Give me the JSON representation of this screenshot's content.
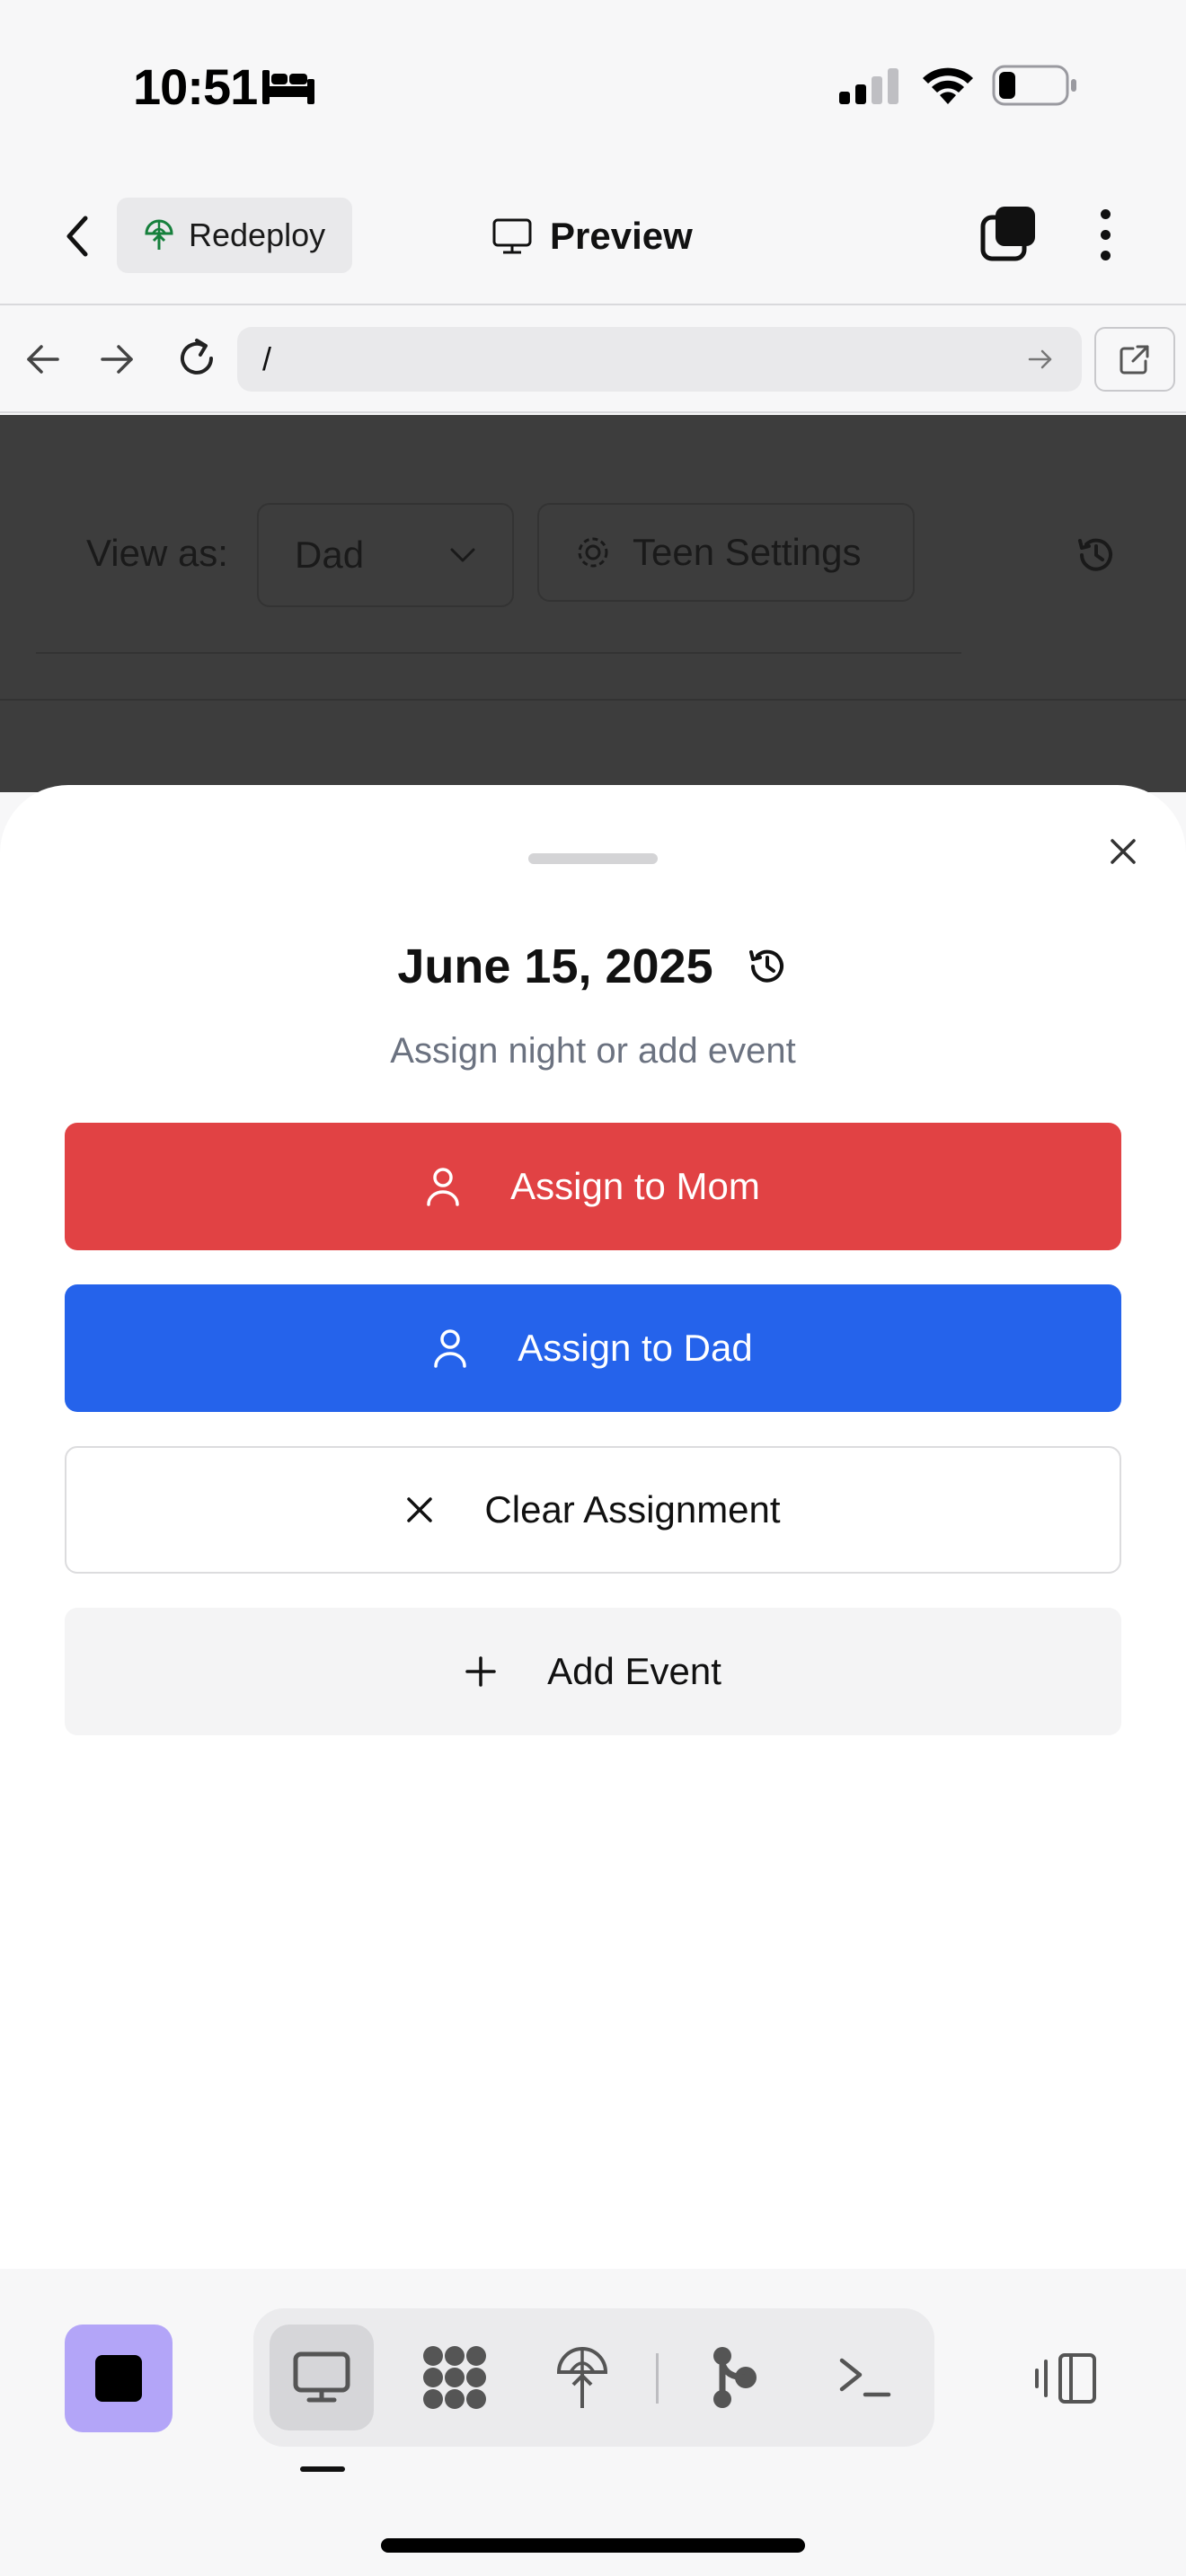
{
  "status_bar": {
    "time": "10:51"
  },
  "header": {
    "redeploy_label": "Redeploy",
    "title": "Preview"
  },
  "browser": {
    "url": "/"
  },
  "webpage": {
    "view_as_label": "View as:",
    "view_as_value": "Dad",
    "teen_settings_label": "Teen Settings"
  },
  "sheet": {
    "title": "June 15, 2025",
    "subtitle": "Assign night or add event",
    "buttons": {
      "assign_mom": "Assign to Mom",
      "assign_dad": "Assign to Dad",
      "clear": "Clear Assignment",
      "add_event": "Add Event"
    }
  },
  "colors": {
    "mom": "#e14244",
    "dad": "#2563eb",
    "stop_button": "#b3a5f8",
    "dim_overlay": "#3d3d3d"
  },
  "icons": [
    "bed-icon",
    "signal-icon",
    "wifi-icon",
    "battery-icon",
    "back-icon",
    "redeploy-icon",
    "monitor-icon",
    "tabs-icon",
    "more-icon",
    "arrow-left-icon",
    "arrow-right-icon",
    "reload-icon",
    "external-link-icon",
    "chevron-down-icon",
    "gear-icon",
    "history-icon",
    "close-icon",
    "user-icon",
    "plus-icon",
    "workflows-icon",
    "deploy-icon",
    "git-icon",
    "shell-icon",
    "layout-toggle-icon"
  ]
}
